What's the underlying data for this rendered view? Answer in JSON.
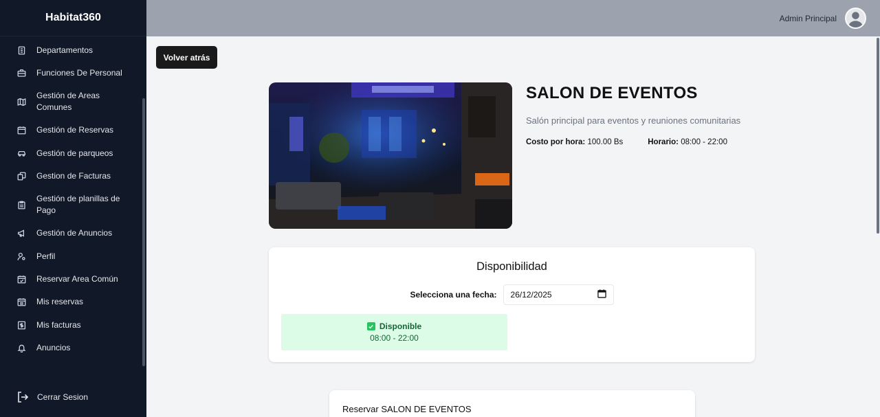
{
  "app": {
    "brand": "Habitat360"
  },
  "sidebar": {
    "items": [
      {
        "label": "Departamentos",
        "icon": "building-icon"
      },
      {
        "label": "Funciones De Personal",
        "icon": "briefcase-icon"
      },
      {
        "label": "Gestión de Areas Comunes",
        "icon": "map-icon"
      },
      {
        "label": "Gestión de Reservas",
        "icon": "calendar-icon"
      },
      {
        "label": "Gestión de parqueos",
        "icon": "car-icon"
      },
      {
        "label": "Gestion de Facturas",
        "icon": "receipt-icon"
      },
      {
        "label": "Gestión de planillas de Pago",
        "icon": "clipboard-icon"
      },
      {
        "label": "Gestión de Anuncios",
        "icon": "megaphone-icon"
      },
      {
        "label": "Perfil",
        "icon": "user-settings-icon"
      },
      {
        "label": "Reservar Area Común",
        "icon": "calendar-check-icon"
      },
      {
        "label": "Mis reservas",
        "icon": "calendar-grid-icon"
      },
      {
        "label": "Mis facturas",
        "icon": "dollar-icon"
      },
      {
        "label": "Anuncios",
        "icon": "bell-icon"
      }
    ],
    "logout_label": "Cerrar Sesion"
  },
  "header": {
    "user_name": "Admin Principal"
  },
  "main": {
    "back_label": "Volver atrás",
    "area": {
      "title": "SALON DE EVENTOS",
      "description": "Salón principal para eventos y reuniones comunitarias",
      "cost_label": "Costo por hora:",
      "cost_value": "100.00 Bs",
      "hours_label": "Horario:",
      "hours_value": "08:00 - 22:00"
    },
    "availability": {
      "title": "Disponibilidad",
      "date_label": "Selecciona una fecha:",
      "date_value": "26/12/2025",
      "status": "Disponible",
      "slot": "08:00 - 22:00",
      "status_color": "#dcfce7"
    },
    "reserve": {
      "title": "Reservar SALON DE EVENTOS"
    }
  }
}
